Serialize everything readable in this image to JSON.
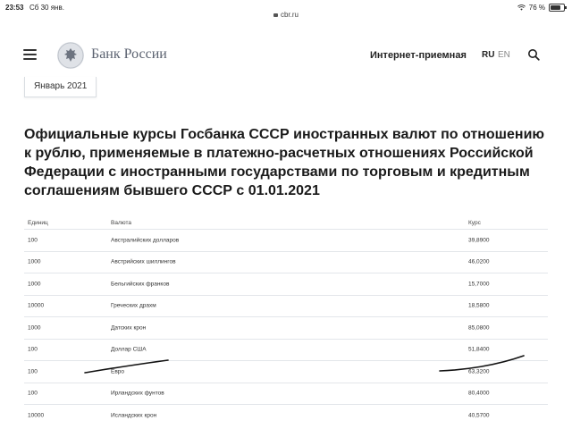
{
  "status_bar": {
    "time": "23:53",
    "date": "Сб 30 янв.",
    "url": "cbr.ru",
    "battery": "76 %"
  },
  "header": {
    "brand": "Банк России",
    "reception_link": "Интернет-приемная",
    "lang_active": "RU",
    "lang_other": "EN"
  },
  "period_selector": "Январь 2021",
  "page_title": "Официальные курсы Госбанка СССР иностранных валют по отношению к рублю, применяемые в платежно-расчетных отношениях Российской Федерации с иностранными государствами по торговым и кредитным соглашениям бывшего СССР с 01.01.2021",
  "table": {
    "headers": [
      "Единиц",
      "Валюта",
      "Курс"
    ],
    "rows": [
      {
        "units": "100",
        "currency": "Австралийских долларов",
        "rate": "39,8900"
      },
      {
        "units": "1000",
        "currency": "Австрийских шиллингов",
        "rate": "46,0200"
      },
      {
        "units": "1000",
        "currency": "Бельгийских франков",
        "rate": "15,7000"
      },
      {
        "units": "10000",
        "currency": "Греческих драхм",
        "rate": "18,5800"
      },
      {
        "units": "1000",
        "currency": "Датских крон",
        "rate": "85,0800"
      },
      {
        "units": "100",
        "currency": "Доллар США",
        "rate": "51,8400"
      },
      {
        "units": "100",
        "currency": "Евро",
        "rate": "63,3200"
      },
      {
        "units": "100",
        "currency": "Ирландских фунтов",
        "rate": "80,4000"
      },
      {
        "units": "10000",
        "currency": "Исландских крон",
        "rate": "40,5700"
      }
    ]
  },
  "colors": {
    "text": "#1a1a1a",
    "brand_gray": "#5b6270",
    "row_border": "#e3e6ea",
    "scribble": "#111111"
  },
  "icons": [
    "menu-icon",
    "bank-emblem-icon",
    "search-icon",
    "wifi-icon",
    "battery-icon",
    "lock-icon"
  ]
}
